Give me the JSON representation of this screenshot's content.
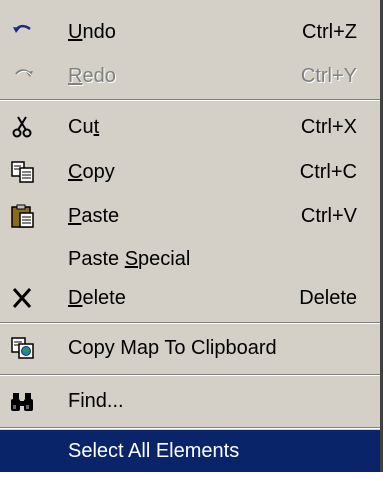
{
  "menu": {
    "items": [
      {
        "key": "undo",
        "pre": "",
        "accel": "U",
        "post": "ndo",
        "shortcut": "Ctrl+Z",
        "icon": "undo-icon",
        "enabled": true
      },
      {
        "key": "redo",
        "pre": "",
        "accel": "R",
        "post": "edo",
        "shortcut": "Ctrl+Y",
        "icon": "redo-icon",
        "enabled": false
      },
      {
        "key": "cut",
        "pre": "Cu",
        "accel": "t",
        "post": "",
        "shortcut": "Ctrl+X",
        "icon": "scissors-icon",
        "enabled": true
      },
      {
        "key": "copy",
        "pre": "",
        "accel": "C",
        "post": "opy",
        "shortcut": "Ctrl+C",
        "icon": "copy-icon",
        "enabled": true
      },
      {
        "key": "paste",
        "pre": "",
        "accel": "P",
        "post": "aste",
        "shortcut": "Ctrl+V",
        "icon": "clipboard-icon",
        "enabled": true
      },
      {
        "key": "paste-special",
        "pre": "Paste ",
        "accel": "S",
        "post": "pecial",
        "shortcut": "",
        "icon": "",
        "enabled": true
      },
      {
        "key": "delete",
        "pre": "",
        "accel": "D",
        "post": "elete",
        "shortcut": "Delete",
        "icon": "delete-x-icon",
        "enabled": true
      },
      {
        "key": "copy-map",
        "pre": "Copy Map To Clipboard",
        "accel": "",
        "post": "",
        "shortcut": "",
        "icon": "copy-map-icon",
        "enabled": true
      },
      {
        "key": "find",
        "pre": "Find...",
        "accel": "",
        "post": "",
        "shortcut": "",
        "icon": "binoculars-icon",
        "enabled": true
      },
      {
        "key": "select-all",
        "pre": "Select All Elements",
        "accel": "",
        "post": "",
        "shortcut": "",
        "icon": "",
        "enabled": true,
        "selected": true
      }
    ]
  },
  "colors": {
    "menu_background": "#d4d0c8",
    "selection_background": "#0a246a",
    "selection_text": "#ffffff",
    "disabled_text": "#808080"
  }
}
